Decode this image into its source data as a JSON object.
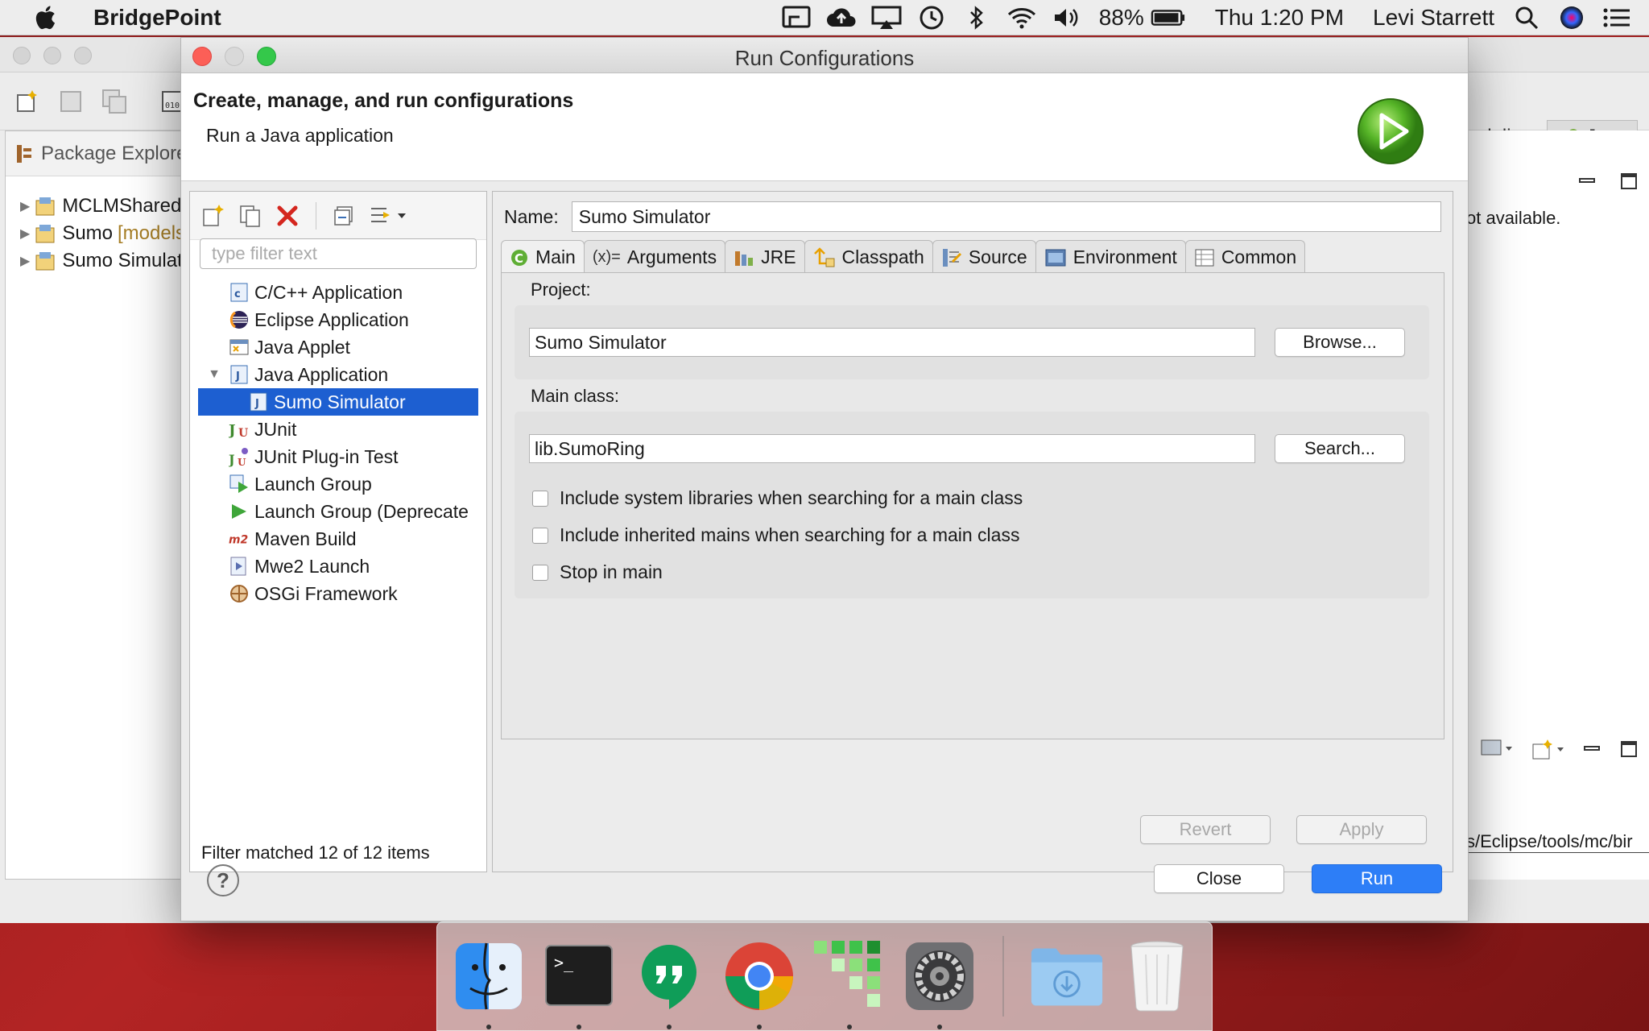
{
  "menubar": {
    "app_name": "BridgePoint",
    "battery": "88%",
    "clock": "Thu 1:20 PM",
    "user": "Levi Starrett"
  },
  "background_window": {
    "left_tab": "Package Explore",
    "tree": [
      "MCLMShared",
      "Sumo",
      "Sumo Simulat"
    ],
    "tree_suffix": "[models",
    "perspective_modeling": "Modeling",
    "perspective_java": "Java",
    "right_text_1": "ot available.",
    "right_text_2": "s/Eclipse/tools/mc/bir"
  },
  "dialog": {
    "title": "Run Configurations",
    "header_title": "Create, manage, and run configurations",
    "header_subtitle": "Run a Java application",
    "filter_placeholder": "type filter text",
    "tree": [
      {
        "label": "C/C++ Application",
        "icon": "c-app-icon",
        "indent": 0
      },
      {
        "label": "Eclipse Application",
        "icon": "eclipse-icon",
        "indent": 0
      },
      {
        "label": "Java Applet",
        "icon": "applet-icon",
        "indent": 0
      },
      {
        "label": "Java Application",
        "icon": "java-app-icon",
        "indent": 0,
        "expanded": true
      },
      {
        "label": "Sumo Simulator",
        "icon": "java-app-icon",
        "indent": 1,
        "selected": true
      },
      {
        "label": "JUnit",
        "icon": "junit-icon",
        "indent": 0
      },
      {
        "label": "JUnit Plug-in Test",
        "icon": "junit-plugin-icon",
        "indent": 0
      },
      {
        "label": "Launch Group",
        "icon": "launch-group-icon",
        "indent": 0
      },
      {
        "label": "Launch Group (Deprecate",
        "icon": "launch-group-deprecated-icon",
        "indent": 0
      },
      {
        "label": "Maven Build",
        "icon": "maven-icon",
        "indent": 0
      },
      {
        "label": "Mwe2 Launch",
        "icon": "mwe2-icon",
        "indent": 0
      },
      {
        "label": "OSGi Framework",
        "icon": "osgi-icon",
        "indent": 0
      }
    ],
    "filter_status": "Filter matched 12 of 12 items",
    "name_label": "Name:",
    "name_value": "Sumo Simulator",
    "tabs": [
      "Main",
      "Arguments",
      "JRE",
      "Classpath",
      "Source",
      "Environment",
      "Common"
    ],
    "tab_arguments_prefix": "(x)=",
    "project_label": "Project:",
    "project_value": "Sumo Simulator",
    "browse_label": "Browse...",
    "main_class_label": "Main class:",
    "main_class_value": "lib.SumoRing",
    "search_label": "Search...",
    "checkboxes": [
      "Include system libraries when searching for a main class",
      "Include inherited mains when searching for a main class",
      "Stop in main"
    ],
    "revert_label": "Revert",
    "apply_label": "Apply",
    "close_label": "Close",
    "run_label": "Run",
    "help_label": "?"
  },
  "colors": {
    "selection": "#1d5fd1",
    "run_button": "#2d7ef7",
    "close_light": "#fc5f57",
    "zoom_light": "#34c84a"
  }
}
